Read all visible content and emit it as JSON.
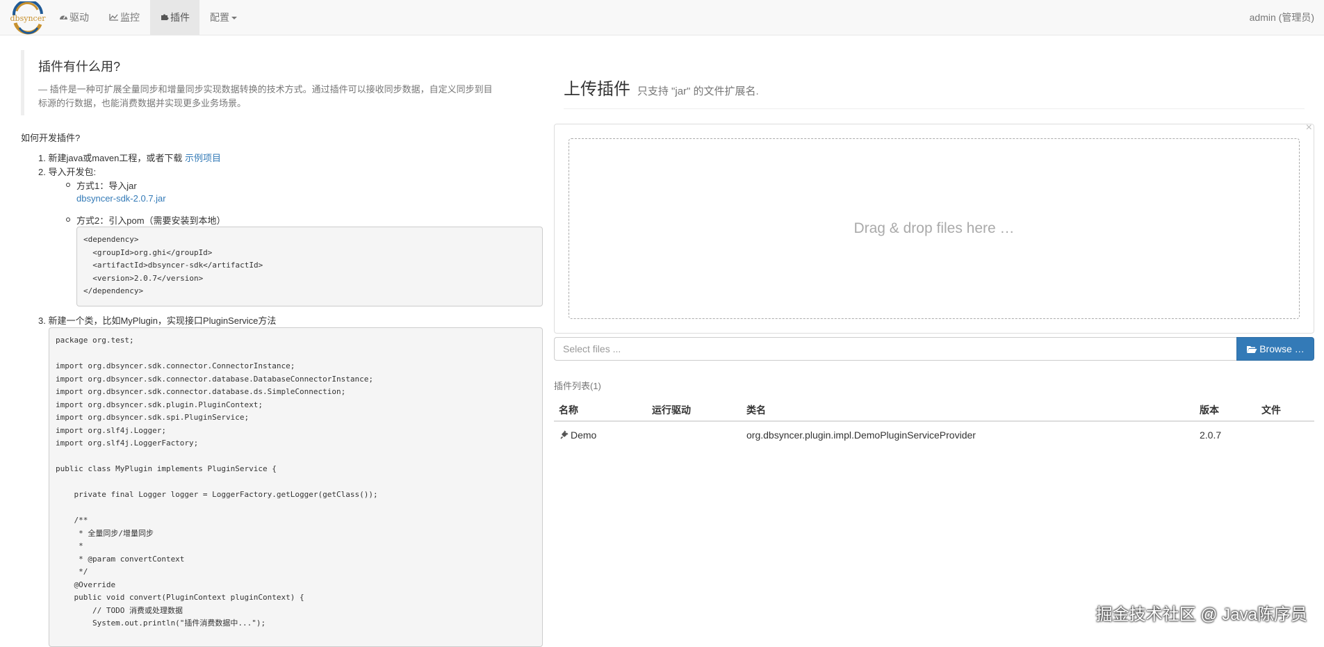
{
  "brand": {
    "logo_text": "dbsyncer"
  },
  "nav": {
    "items": [
      {
        "label": "驱动",
        "icon": "dashboard-icon"
      },
      {
        "label": "监控",
        "icon": "line-chart-icon"
      },
      {
        "label": "插件",
        "icon": "puzzle-icon"
      },
      {
        "label": "配置",
        "icon": "caret-down-icon"
      }
    ],
    "active": "插件",
    "user": "admin (管理员)"
  },
  "intro": {
    "heading": "插件有什么用?",
    "description_line1": "— 插件是一种可扩展全量同步和增量同步实现数据转换的技术方式。通过插件可以接收同步数据，自定义同步到目",
    "description_line2": "标源的行数据，也能消费数据并实现更多业务场景。"
  },
  "guide": {
    "title": "如何开发插件?",
    "step1_text": "1. 新建java或maven工程，或者下载 ",
    "step1_link": "示例项目",
    "step2_text": "2. 导入开发包:",
    "option1_label": "方式1：导入jar",
    "option1_link": "dbsyncer-sdk-2.0.7.jar",
    "option2_label": "方式2：引入pom（需要安装到本地）",
    "pom_code": "<dependency>\n  <groupId>org.ghi</groupId>\n  <artifactId>dbsyncer-sdk</artifactId>\n  <version>2.0.7</version>\n</dependency>",
    "step3_text": "3. 新建一个类，比如MyPlugin，实现接口PluginService方法",
    "java_code": "package org.test;\n\nimport org.dbsyncer.sdk.connector.ConnectorInstance;\nimport org.dbsyncer.sdk.connector.database.DatabaseConnectorInstance;\nimport org.dbsyncer.sdk.connector.database.ds.SimpleConnection;\nimport org.dbsyncer.sdk.plugin.PluginContext;\nimport org.dbsyncer.sdk.spi.PluginService;\nimport org.slf4j.Logger;\nimport org.slf4j.LoggerFactory;\n\npublic class MyPlugin implements PluginService {\n\n    private final Logger logger = LoggerFactory.getLogger(getClass());\n\n    /**\n     * 全量同步/增量同步\n     *\n     * @param convertContext\n     */\n    @Override\n    public void convert(PluginContext pluginContext) {\n        // TODO 消费或处理数据\n        System.out.println(\"插件消费数据中...\");"
  },
  "upload": {
    "title": "上传插件",
    "subtitle": "只支持 \"jar\" 的文件扩展名.",
    "drop_text": "Drag & drop files here …",
    "close": "×",
    "placeholder": "Select files ...",
    "browse_label": "Browse …"
  },
  "plugins": {
    "title": "插件列表(1)",
    "columns": [
      "名称",
      "运行驱动",
      "类名",
      "版本",
      "文件"
    ],
    "rows": [
      {
        "name": "Demo",
        "driver": "",
        "class_name": "org.dbsyncer.plugin.impl.DemoPluginServiceProvider",
        "version": "2.0.7",
        "file": ""
      }
    ]
  },
  "watermark": "掘金技术社区 @ Java陈序员",
  "colors": {
    "primary": "#337ab7",
    "navbar_bg": "#f8f8f8",
    "logo_gold": "#c8912e",
    "logo_blue": "#1f5a96"
  }
}
